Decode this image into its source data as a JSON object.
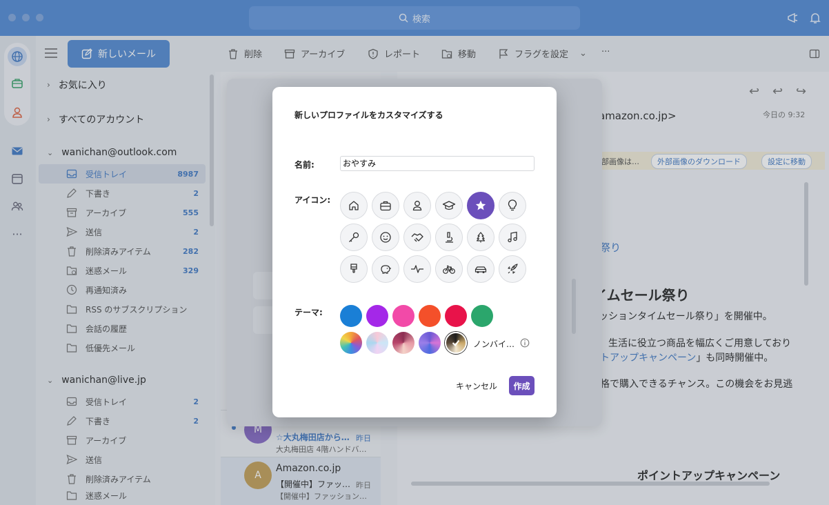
{
  "titlebar": {
    "search_placeholder": "検索"
  },
  "sidebar": {
    "new_mail_label": "新しいメール",
    "favorites_label": "お気に入り",
    "all_accounts_label": "すべてのアカウント",
    "accounts": [
      {
        "name": "wanichan@outlook.com",
        "folders": [
          {
            "label": "受信トレイ",
            "count": "8987"
          },
          {
            "label": "下書き",
            "count": "2"
          },
          {
            "label": "アーカイブ",
            "count": "555"
          },
          {
            "label": "送信",
            "count": "2"
          },
          {
            "label": "削除済みアイテム",
            "count": "282"
          },
          {
            "label": "迷惑メール",
            "count": "329"
          },
          {
            "label": "再通知済み",
            "count": ""
          },
          {
            "label": "RSS のサブスクリプション",
            "count": ""
          },
          {
            "label": "会話の履歴",
            "count": ""
          },
          {
            "label": "低優先メール",
            "count": ""
          }
        ]
      },
      {
        "name": "wanichan@live.jp",
        "folders": [
          {
            "label": "受信トレイ",
            "count": "2"
          },
          {
            "label": "下書き",
            "count": "2"
          },
          {
            "label": "アーカイブ",
            "count": ""
          },
          {
            "label": "送信",
            "count": ""
          },
          {
            "label": "削除済みアイテム",
            "count": ""
          },
          {
            "label": "迷惑メール",
            "count": ""
          }
        ]
      }
    ]
  },
  "toolbar": {
    "delete": "削除",
    "archive": "アーカイブ",
    "report": "レポート",
    "move": "移動",
    "flag": "フラグを設定",
    "more": "···"
  },
  "messages": [
    {
      "avatar": "M",
      "subject": "☆大丸梅田店から…",
      "date": "昨日",
      "preview": "大丸梅田店 4階ハンドバ…"
    },
    {
      "sender": "Amazon.co.jp",
      "avatar": "A",
      "subject": "【開催中】ファッ…",
      "date": "昨日",
      "preview": "【開催中】ファッション…"
    }
  ],
  "reading": {
    "from_fragment": "amazon.co.jp>",
    "time": "今日の 9:32",
    "info_fragment": "部画像は…",
    "download_images": "外部画像のダウンロード",
    "goto_settings": "設定に移動",
    "link_fragment": "祭り",
    "heading_fragment": "イムセール祭り",
    "line1": "ッションタイムセール祭り」を開催中。",
    "line2": "生活に役立つ商品を幅広くご用意しており",
    "line3_link": "トアップキャンペーン",
    "line3_rest": "」も同時開催中。",
    "line4": "格で購入できるチャンス。この機会をお見逃",
    "banner": "ポイントアップキャンペーン"
  },
  "dialog": {
    "title": "新しいプロファイルをカスタマイズする",
    "name_label": "名前:",
    "name_value": "おやすみ",
    "icon_label": "アイコン:",
    "icons": [
      "home-icon",
      "briefcase-icon",
      "person-icon",
      "graduation-cap-icon",
      "star-icon",
      "lightbulb-icon",
      "key-icon",
      "smiley-icon",
      "handshake-icon",
      "microscope-icon",
      "tree-icon",
      "music-note-icon",
      "paintbrush-icon",
      "piggy-bank-icon",
      "pulse-icon",
      "bicycle-icon",
      "car-icon",
      "rocket-icon"
    ],
    "selected_icon": "star-icon",
    "theme_label": "テーマ:",
    "solid_colors": [
      "#1a7fd6",
      "#a428e8",
      "#f24aa8",
      "#f4502a",
      "#e8134a",
      "#2ba66c"
    ],
    "gradient_themes": [
      "rainbow-gradient",
      "pastel-gradient",
      "rose-gradient",
      "violet-gradient",
      "neutral-gradient"
    ],
    "selected_theme": "neutral-gradient",
    "neutral_label": "ノンバイ…",
    "cancel": "キャンセル",
    "create": "作成"
  }
}
